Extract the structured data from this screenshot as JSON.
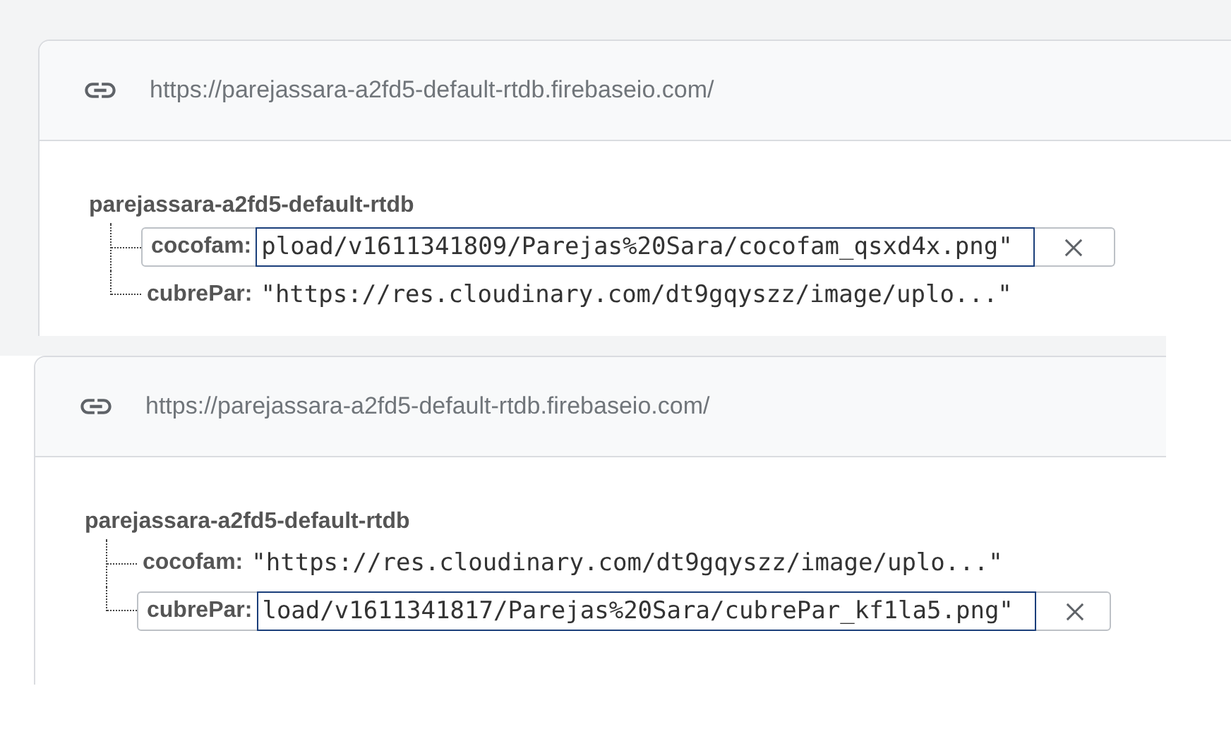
{
  "panels": [
    {
      "url": "https://parejassara-a2fd5-default-rtdb.firebaseio.com/",
      "root": "parejassara-a2fd5-default-rtdb",
      "children": [
        {
          "key": "cocofam:",
          "value": "pload/v1611341809/Parejas%20Sara/cocofam_qsxd4x.png\"",
          "editing": true
        },
        {
          "key": "cubrePar:",
          "value": "\"https://res.cloudinary.com/dt9gqyszz/image/uplo...\"",
          "editing": false
        }
      ]
    },
    {
      "url": "https://parejassara-a2fd5-default-rtdb.firebaseio.com/",
      "root": "parejassara-a2fd5-default-rtdb",
      "children": [
        {
          "key": "cocofam:",
          "value": "\"https://res.cloudinary.com/dt9gqyszz/image/uplo...\"",
          "editing": false
        },
        {
          "key": "cubrePar:",
          "value": "load/v1611341817/Parejas%20Sara/cubrePar_kf1la5.png\"",
          "editing": true
        }
      ]
    }
  ]
}
